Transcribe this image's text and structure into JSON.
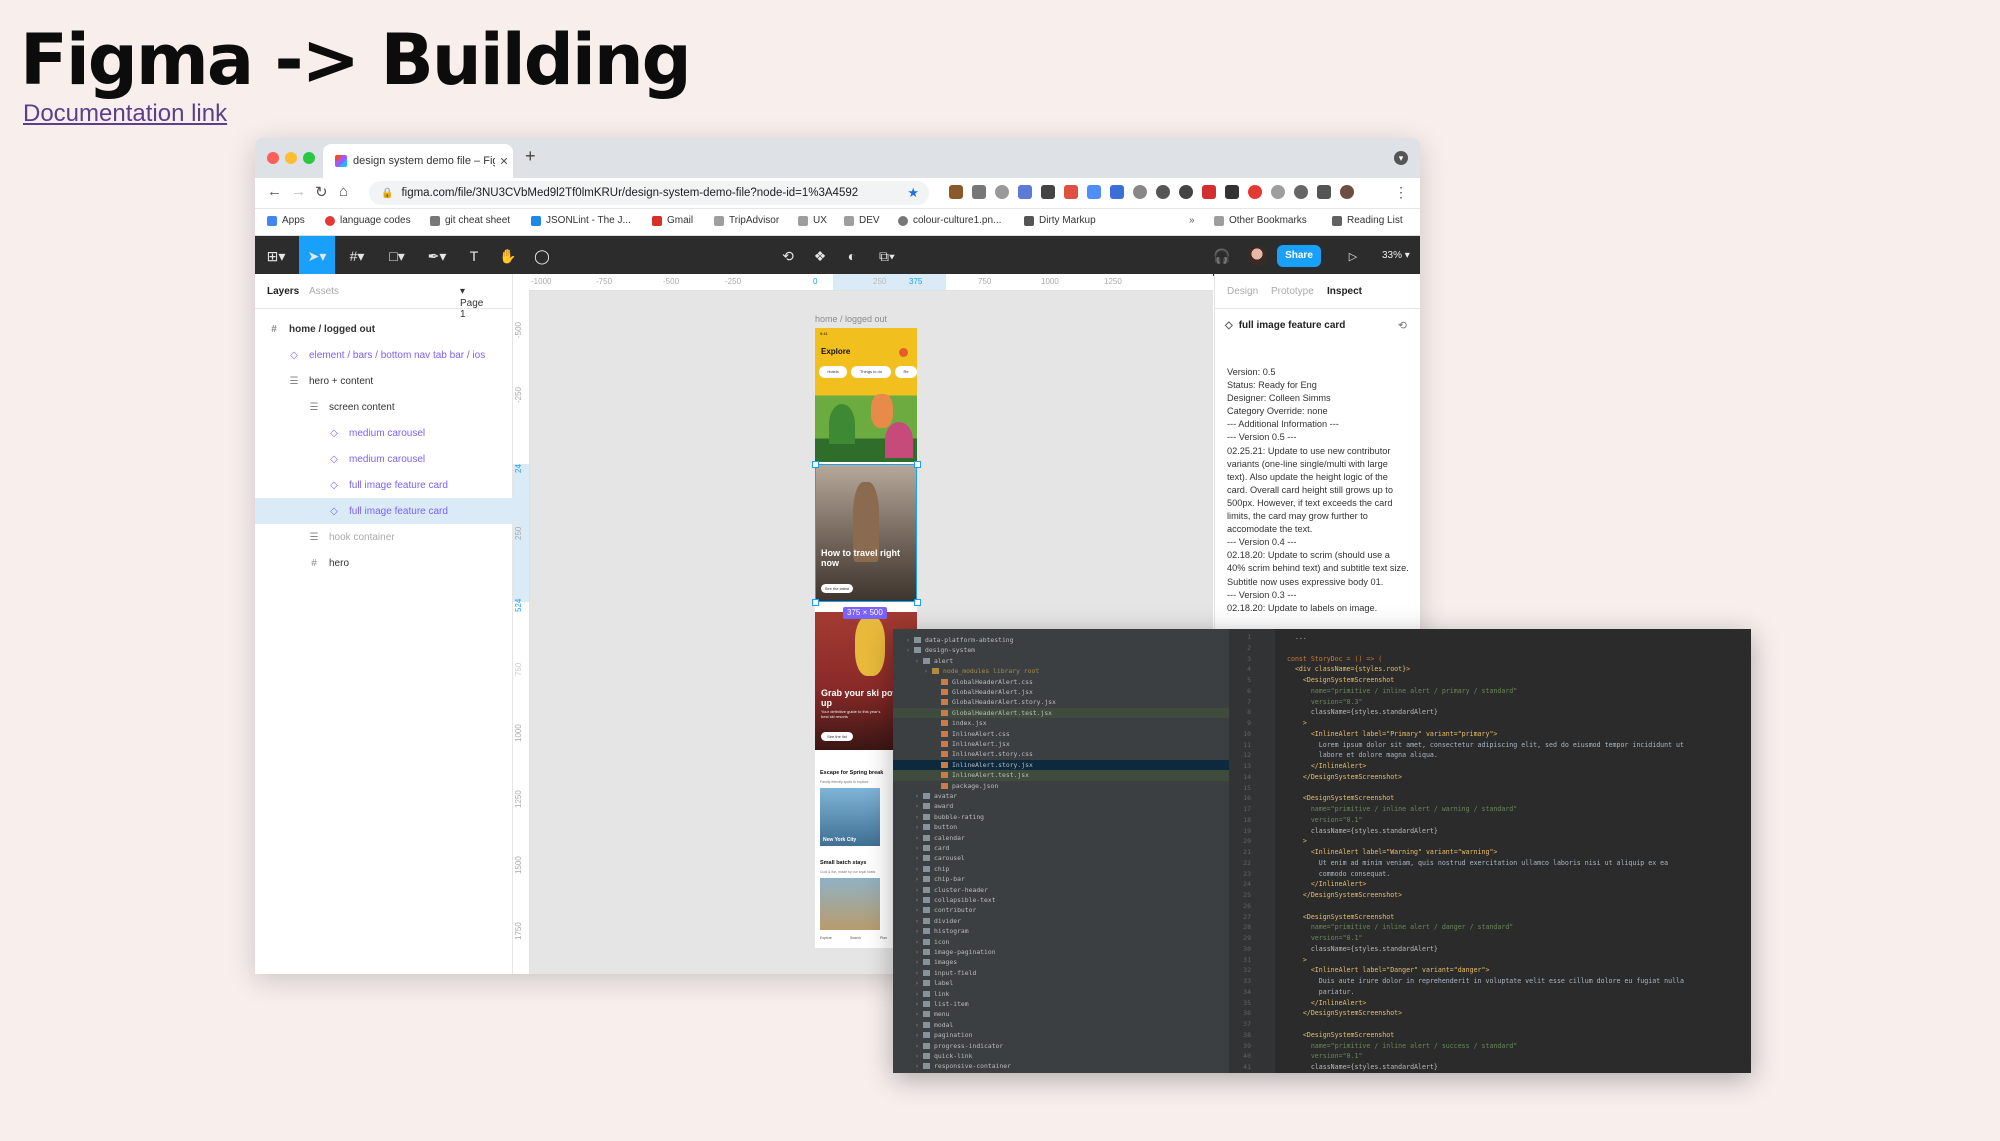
{
  "slide": {
    "title": "Figma -> Building",
    "link_text": "Documentation link"
  },
  "browser": {
    "tab_title": "design system demo file – Figma",
    "url": "figma.com/file/3NU3CVbMed9l2Tf0lmKRUr/design-system-demo-file?node-id=1%3A4592",
    "bookmarks": [
      "Apps",
      "language codes",
      "git cheat sheet",
      "JSONLint - The J...",
      "Gmail",
      "TripAdvisor",
      "UX",
      "DEV",
      "colour-culture1.pn...",
      "Dirty Markup"
    ],
    "bookmarks_more": "»",
    "bookmarks_right": [
      "Other Bookmarks",
      "Reading List"
    ]
  },
  "figma": {
    "share_label": "Share",
    "zoom": "33%",
    "left_tabs": {
      "layers": "Layers",
      "assets": "Assets",
      "page": "Page 1"
    },
    "layers": [
      {
        "label": "home / logged out",
        "icon": "frame-icon",
        "type": "frame"
      },
      {
        "label": "element / bars / bottom nav tab bar / ios",
        "icon": "instance-icon",
        "type": "instance"
      },
      {
        "label": "hero + content",
        "icon": "autolayout-icon",
        "type": "group"
      },
      {
        "label": "screen content",
        "icon": "autolayout-icon",
        "type": "group"
      },
      {
        "label": "medium carousel",
        "icon": "instance-icon",
        "type": "instance"
      },
      {
        "label": "medium carousel",
        "icon": "instance-icon",
        "type": "instance"
      },
      {
        "label": "full image feature card",
        "icon": "instance-icon",
        "type": "instance"
      },
      {
        "label": "full image feature card",
        "icon": "instance-icon",
        "type": "instance-selected"
      },
      {
        "label": "hook container",
        "icon": "autolayout-icon",
        "type": "hidden"
      },
      {
        "label": "hero",
        "icon": "frame-icon",
        "type": "frame"
      }
    ],
    "ruler_top": [
      "-1000",
      "-750",
      "-500",
      "-250",
      "0",
      "250",
      "375",
      "750",
      "1000",
      "1250"
    ],
    "ruler_left": [
      "-500",
      "-250",
      "24",
      "250",
      "524",
      "750",
      "1000",
      "1250",
      "1500",
      "1750"
    ],
    "canvas": {
      "frame_label": "home / logged out",
      "size_badge": "375 × 500",
      "phone": {
        "time": "9:41",
        "explore_title": "Explore",
        "pills": [
          "Hotels",
          "Things to do",
          "Re"
        ],
        "card1_title": "How to travel right now",
        "card1_cta": "See the latest",
        "card2_title": "Grab your ski pow(er) up",
        "card2_subtitle": "Your definitive guide to this year's best ski resorts",
        "card2_cta": "See the list",
        "section1": "Escape for Spring break",
        "section1_sub": "Family-friendly spots to explore",
        "section1_item": "New York City",
        "section2": "Small batch stays",
        "section2_sub": "Cool & fun, made by our loyal hosts",
        "tabs": [
          "Explore",
          "Search",
          "Plan"
        ]
      }
    },
    "right_tabs": {
      "design": "Design",
      "prototype": "Prototype",
      "inspect": "Inspect"
    },
    "selected_title": "full image feature card",
    "description": "Version: 0.5\nStatus: Ready for Eng\nDesigner: Colleen Simms\nCategory Override: none\n--- Additional Information ---\n--- Version 0.5 ---\n02.25.21: Update to use new contributor variants (one-line single/multi with large text). Also update the height logic of the card. Overall card height still grows up to 500px. However, if text exceeds the card limits, the card may grow further to accomodate the text.\n--- Version 0.4 ---\n02.18.20: Update to scrim (should use a 40% scrim behind text) and subtitle text size. Subtitle now uses expressive body 01.\n--- Version 0.3 ---\n02.18.20: Update to labels on image."
  },
  "editor": {
    "tree": [
      {
        "label": "data-platform-abtesting",
        "depth": 1,
        "kind": "folder"
      },
      {
        "label": "design-system",
        "depth": 1,
        "kind": "folder"
      },
      {
        "label": "alert",
        "depth": 2,
        "kind": "folder"
      },
      {
        "label": "node_modules  library root",
        "depth": 3,
        "kind": "folder-ex"
      },
      {
        "label": "GlobalHeaderAlert.css",
        "depth": 4,
        "kind": "file"
      },
      {
        "label": "GlobalHeaderAlert.jsx",
        "depth": 4,
        "kind": "file"
      },
      {
        "label": "GlobalHeaderAlert.story.jsx",
        "depth": 4,
        "kind": "file"
      },
      {
        "label": "GlobalHeaderAlert.test.jsx",
        "depth": 4,
        "kind": "file-g"
      },
      {
        "label": "index.jsx",
        "depth": 4,
        "kind": "file"
      },
      {
        "label": "InlineAlert.css",
        "depth": 4,
        "kind": "file"
      },
      {
        "label": "InlineAlert.jsx",
        "depth": 4,
        "kind": "file"
      },
      {
        "label": "InlineAlert.story.css",
        "depth": 4,
        "kind": "file"
      },
      {
        "label": "InlineAlert.story.jsx",
        "depth": 4,
        "kind": "file-sel"
      },
      {
        "label": "InlineAlert.test.jsx",
        "depth": 4,
        "kind": "file-g"
      },
      {
        "label": "package.json",
        "depth": 4,
        "kind": "file"
      },
      {
        "label": "avatar",
        "depth": 2,
        "kind": "folder"
      },
      {
        "label": "award",
        "depth": 2,
        "kind": "folder"
      },
      {
        "label": "bubble-rating",
        "depth": 2,
        "kind": "folder"
      },
      {
        "label": "button",
        "depth": 2,
        "kind": "folder"
      },
      {
        "label": "calendar",
        "depth": 2,
        "kind": "folder"
      },
      {
        "label": "card",
        "depth": 2,
        "kind": "folder"
      },
      {
        "label": "carousel",
        "depth": 2,
        "kind": "folder"
      },
      {
        "label": "chip",
        "depth": 2,
        "kind": "folder"
      },
      {
        "label": "chip-bar",
        "depth": 2,
        "kind": "folder"
      },
      {
        "label": "cluster-header",
        "depth": 2,
        "kind": "folder"
      },
      {
        "label": "collapsible-text",
        "depth": 2,
        "kind": "folder"
      },
      {
        "label": "contributor",
        "depth": 2,
        "kind": "folder"
      },
      {
        "label": "divider",
        "depth": 2,
        "kind": "folder"
      },
      {
        "label": "histogram",
        "depth": 2,
        "kind": "folder"
      },
      {
        "label": "icon",
        "depth": 2,
        "kind": "folder"
      },
      {
        "label": "image-pagination",
        "depth": 2,
        "kind": "folder"
      },
      {
        "label": "images",
        "depth": 2,
        "kind": "folder"
      },
      {
        "label": "input-field",
        "depth": 2,
        "kind": "folder"
      },
      {
        "label": "label",
        "depth": 2,
        "kind": "folder"
      },
      {
        "label": "link",
        "depth": 2,
        "kind": "folder"
      },
      {
        "label": "list-item",
        "depth": 2,
        "kind": "folder"
      },
      {
        "label": "menu",
        "depth": 2,
        "kind": "folder"
      },
      {
        "label": "modal",
        "depth": 2,
        "kind": "folder"
      },
      {
        "label": "pagination",
        "depth": 2,
        "kind": "folder"
      },
      {
        "label": "progress-indicator",
        "depth": 2,
        "kind": "folder"
      },
      {
        "label": "quick-link",
        "depth": 2,
        "kind": "folder"
      },
      {
        "label": "responsive-container",
        "depth": 2,
        "kind": "folder"
      }
    ],
    "line_numbers": [
      "1",
      "2",
      "3",
      "4",
      "5",
      "6",
      "7",
      "8",
      "9",
      "10",
      "11",
      "12",
      "13",
      "14",
      "15",
      "16",
      "17",
      "18",
      "19",
      "20",
      "21",
      "22",
      "23",
      "24",
      "25",
      "26",
      "27",
      "28",
      "29",
      "30",
      "31",
      "32",
      "33",
      "34",
      "35",
      "36",
      "37",
      "38",
      "39",
      "40",
      "41",
      "42",
      "43",
      "44",
      "45",
      "46",
      "47",
      "48",
      "49",
      "50",
      "51",
      "52",
      "53",
      "54",
      "55"
    ],
    "code": [
      "  ...",
      "",
      "const StoryDoc = () => (",
      "  <div className={styles.root}>",
      "    <DesignSystemScreenshot",
      "      name=\"primitive / inline alert / primary / standard\"",
      "      version=\"0.3\"",
      "      className={styles.standardAlert}",
      "    >",
      "      <InlineAlert label=\"Primary\" variant=\"primary\">",
      "        Lorem ipsum dolor sit amet, consectetur adipiscing elit, sed do eiusmod tempor incididunt ut",
      "        labore et dolore magna aliqua.",
      "      </InlineAlert>",
      "    </DesignSystemScreenshot>",
      "",
      "    <DesignSystemScreenshot",
      "      name=\"primitive / inline alert / warning / standard\"",
      "      version=\"0.1\"",
      "      className={styles.standardAlert}",
      "    >",
      "      <InlineAlert label=\"Warning\" variant=\"warning\">",
      "        Ut enim ad minim veniam, quis nostrud exercitation ullamco laboris nisi ut aliquip ex ea",
      "        commodo consequat.",
      "      </InlineAlert>",
      "    </DesignSystemScreenshot>",
      "",
      "    <DesignSystemScreenshot",
      "      name=\"primitive / inline alert / danger / standard\"",
      "      version=\"0.1\"",
      "      className={styles.standardAlert}",
      "    >",
      "      <InlineAlert label=\"Danger\" variant=\"danger\">",
      "        Duis aute irure dolor in reprehenderit in voluptate velit esse cillum dolore eu fugiat nulla",
      "        pariatur.",
      "      </InlineAlert>",
      "    </DesignSystemScreenshot>",
      "",
      "    <DesignSystemScreenshot",
      "      name=\"primitive / inline alert / success / standard\"",
      "      version=\"0.1\"",
      "      className={styles.standardAlert}"
    ]
  },
  "colors": {
    "slide_bg": "#f8efed",
    "figma_blue": "#18a0fb",
    "component_purple": "#7b61ff",
    "figma_toolbar": "#2c2c2c",
    "editor_bg": "#2b2b2b"
  }
}
